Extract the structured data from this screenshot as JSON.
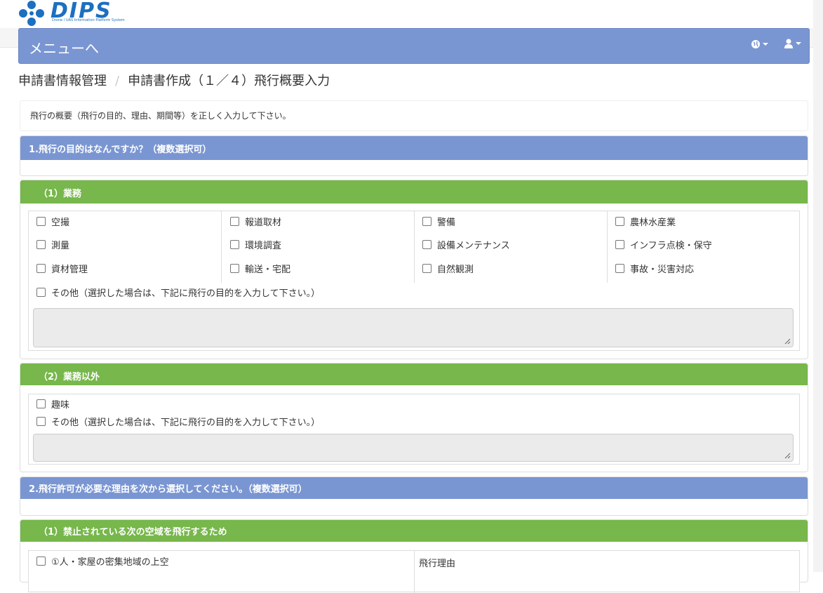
{
  "header": {
    "logo_text": "DIPS",
    "logo_sub": "Drone / UAS Information Platform System",
    "menu_label": "メニューへ"
  },
  "breadcrumb": {
    "item1": "申請書情報管理",
    "separator": "/",
    "item2": "申請書作成（１／４）飛行概要入力"
  },
  "intro": "飛行の概要（飛行の目的、理由、期間等）を正しく入力して下さい。",
  "section1": {
    "title": "1.飛行の目的はなんですか？（複数選択可）",
    "business": {
      "title": "（1）業務",
      "col1": [
        "空撮",
        "測量",
        "資材管理"
      ],
      "col2": [
        "報道取材",
        "環境調査",
        "輸送・宅配"
      ],
      "col3": [
        "警備",
        "設備メンテナンス",
        "自然観測"
      ],
      "col4": [
        "農林水産業",
        "インフラ点検・保守",
        "事故・災害対応"
      ],
      "other": "その他（選択した場合は、下記に飛行の目的を入力して下さい。）"
    },
    "nonbusiness": {
      "title": "（2）業務以外",
      "hobby": "趣味",
      "other": "その他（選択した場合は、下記に飛行の目的を入力して下さい。）"
    }
  },
  "section2": {
    "title": "2.飛行許可が必要な理由を次から選択してください。（複数選択可）",
    "prohibited": {
      "title": "（1）禁止されている次の空域を飛行するため",
      "item1": "①人・家屋の密集地域の上空",
      "reason_header": "飛行理由"
    }
  },
  "colors": {
    "nav_blue": "#7a96d2",
    "section_green": "#77b74b",
    "logo_blue": "#1d6fc0"
  }
}
